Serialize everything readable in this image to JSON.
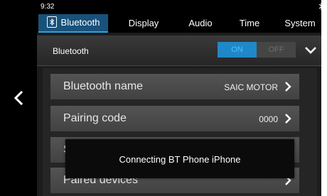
{
  "status_bar": {
    "time": "9:32",
    "bluetooth_icon": "bluetooth-icon"
  },
  "navigation": {
    "back_icon": "chevron-left-icon"
  },
  "tabs": [
    {
      "label": "Bluetooth",
      "icon": "bluetooth-icon",
      "active": true
    },
    {
      "label": "Display",
      "active": false
    },
    {
      "label": "Audio",
      "active": false
    },
    {
      "label": "Time",
      "active": false
    },
    {
      "label": "System",
      "active": false
    }
  ],
  "bluetooth_header": {
    "label": "Bluetooth",
    "toggle_on": "ON",
    "toggle_off": "OFF",
    "toggle_state": "on",
    "expand_icon": "chevron-down-icon"
  },
  "settings_list": [
    {
      "label": "Bluetooth name",
      "value": "SAIC MOTOR"
    },
    {
      "label": "Pairing code",
      "value": "0000"
    },
    {
      "label": "S",
      "value": ""
    },
    {
      "label": "Paired devices",
      "value": ""
    }
  ],
  "toast": {
    "message": "Connecting BT Phone iPhone"
  },
  "colors": {
    "accent": "#1e88c8",
    "active_tab": "#16527c",
    "background": "#1c1c1c",
    "list_item": "#4a4a4a"
  }
}
